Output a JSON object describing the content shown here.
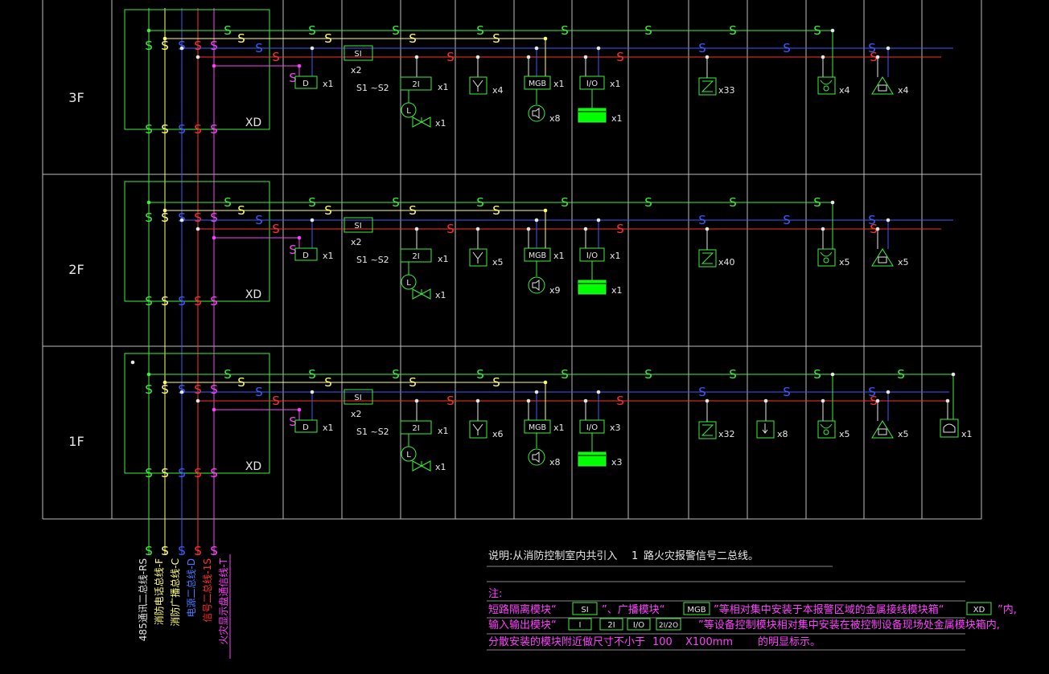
{
  "floors": [
    {
      "label": "3F",
      "panel": "XD",
      "counts": {
        "d": "x1",
        "si": "x2",
        "range": "S1 ~S2",
        "z1": "x1",
        "valve": "x1",
        "spk": "x4",
        "mgb": "x1",
        "horn": "x8",
        "io": "x1",
        "bar": "x1",
        "smoke": "x33",
        "heat": "",
        "tel": "x4",
        "alarm": "x4",
        "call": ""
      }
    },
    {
      "label": "2F",
      "panel": "XD",
      "counts": {
        "d": "x1",
        "si": "x2",
        "range": "S1 ~S2",
        "z1": "x1",
        "valve": "x1",
        "spk": "x5",
        "mgb": "x1",
        "horn": "x9",
        "io": "x1",
        "bar": "x1",
        "smoke": "x40",
        "heat": "",
        "tel": "x5",
        "alarm": "x5",
        "call": ""
      }
    },
    {
      "label": "1F",
      "panel": "XD",
      "counts": {
        "d": "x1",
        "si": "x2",
        "range": "S1 ~S2",
        "z1": "x1",
        "valve": "x1",
        "spk": "x6",
        "mgb": "x1",
        "horn": "x8",
        "io": "x3",
        "bar": "x3",
        "smoke": "x32",
        "heat": "x8",
        "tel": "x5",
        "alarm": "x5",
        "call": "x1"
      }
    }
  ],
  "module_labels": {
    "d": "D",
    "si": "SI",
    "z1": "2I",
    "mgb": "MGB",
    "io": "I/O",
    "l": "L",
    "s": "S"
  },
  "riser_lines": [
    {
      "label": "485通讯二总线-RS",
      "color": "#e0e0e0"
    },
    {
      "label": "消防电话总线-F",
      "color": "#ffff70"
    },
    {
      "label": "消防广播总线-C",
      "color": "#ffff70"
    },
    {
      "label": "电源二总线-D",
      "color": "#4a78ff"
    },
    {
      "label": "信号二总线-1S",
      "color": "#ff3030"
    },
    {
      "label": "火灾显示盘通信线-T",
      "color": "#ff40ff"
    }
  ],
  "notes": {
    "heading": "说明:从消防控制室内共引入",
    "count": "1",
    "tail": "路火灾报警信号二总线。",
    "note_label": "注:",
    "line1_a": "短路隔离模块“",
    "line1_b": "”、广播模块“",
    "line1_c": "”等相对集中安装于本报警区域的金属接线模块箱“",
    "line1_d": "”内,",
    "line2_a": "输入输出模块“",
    "line2_b": "”等设备控制模块相对集中安装在被控制设备现场处金属模块箱内,",
    "line3_a": "分散安装的模块附近做尺寸不小于",
    "line3_b": "100",
    "line3_c": "X100mm",
    "line3_d": "的明显标示。",
    "box_si": "SI",
    "box_mgb": "MGB",
    "box_xd": "XD",
    "box_i": "I",
    "box_2i": "2I",
    "box_io": "I/O",
    "box_2i2o": "2I/2O"
  },
  "colors": {
    "green": "#3cf03c",
    "blue": "#3a5cff",
    "red": "#ff3030",
    "yellow": "#ffff70",
    "magenta": "#ff40ff",
    "white": "#e6e6e6",
    "grid": "#bcbcbc"
  }
}
